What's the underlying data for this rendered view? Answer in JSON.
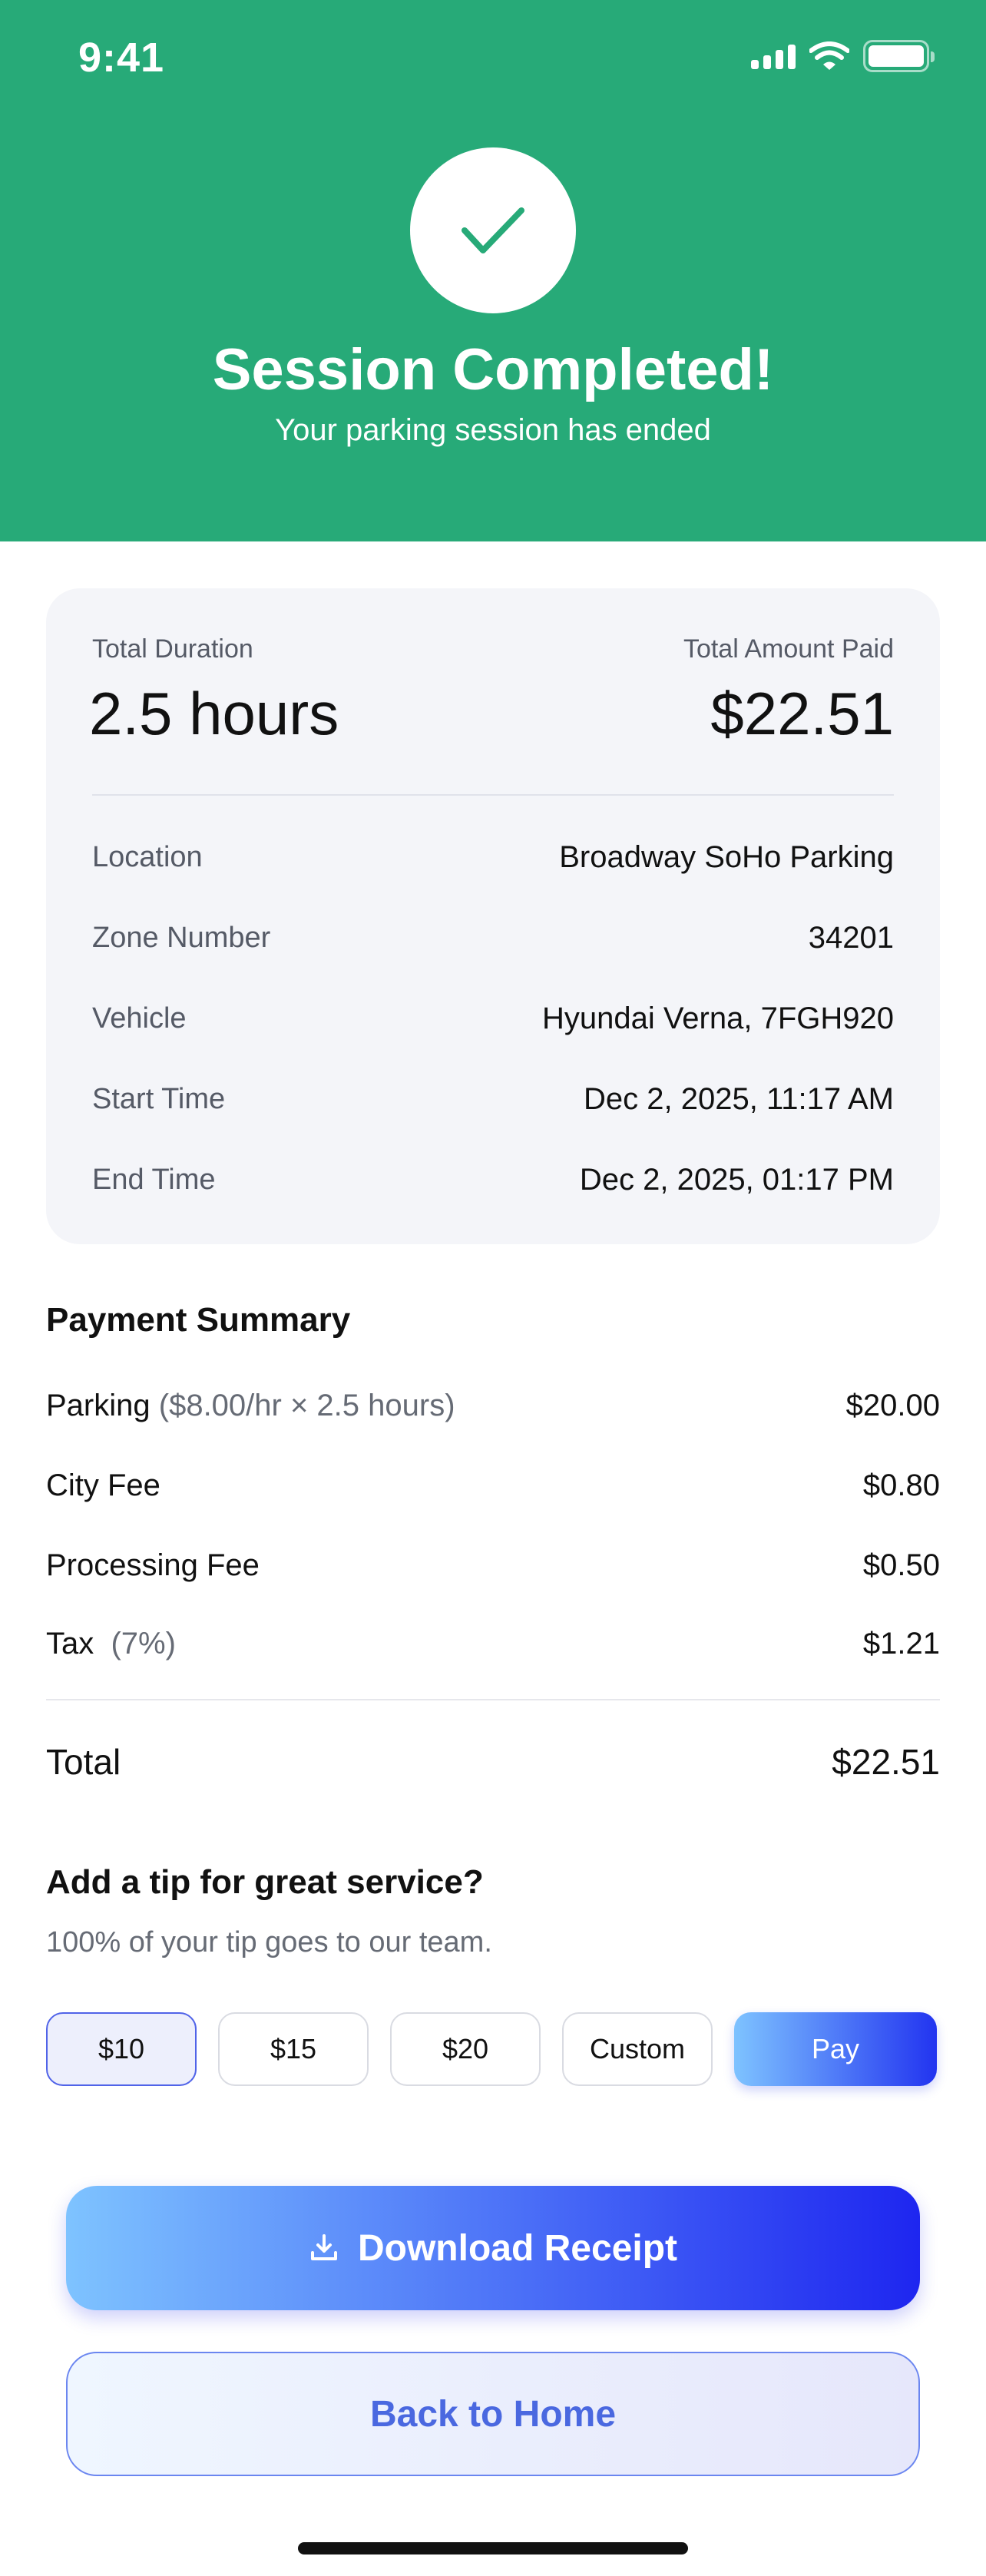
{
  "status_bar": {
    "time": "9:41"
  },
  "header": {
    "title": "Session Completed!",
    "subtitle": "Your parking session has ended",
    "color": "#27AA78"
  },
  "summary": {
    "duration_label": "Total Duration",
    "duration_value": "2.5 hours",
    "amount_label": "Total Amount Paid",
    "amount_value": "$22.51",
    "details": [
      {
        "label": "Location",
        "value": "Broadway SoHo Parking"
      },
      {
        "label": "Zone Number",
        "value": "34201"
      },
      {
        "label": "Vehicle",
        "value": "Hyundai Verna, 7FGH920"
      },
      {
        "label": "Start Time",
        "value": "Dec 2, 2025, 11:17 AM"
      },
      {
        "label": "End Time",
        "value": "Dec 2, 2025, 01:17 PM"
      }
    ]
  },
  "payment": {
    "title": "Payment Summary",
    "rows": [
      {
        "label": "Parking",
        "note": "($8.00/hr × 2.5 hours)",
        "value": "$20.00"
      },
      {
        "label": "City Fee",
        "note": "",
        "value": "$0.80"
      },
      {
        "label": "Processing Fee",
        "note": "",
        "value": "$0.50"
      },
      {
        "label": "Tax",
        "note": "(7%)",
        "value": "$1.21"
      }
    ],
    "total_label": "Total",
    "total_value": "$22.51"
  },
  "tip": {
    "title": "Add a tip for great service?",
    "subtitle": "100% of your tip goes to our team.",
    "options": [
      "$10",
      "$15",
      "$20",
      "Custom"
    ],
    "selected": "$10",
    "pay_label": "Pay"
  },
  "actions": {
    "download_label": "Download Receipt",
    "home_label": "Back to Home"
  }
}
